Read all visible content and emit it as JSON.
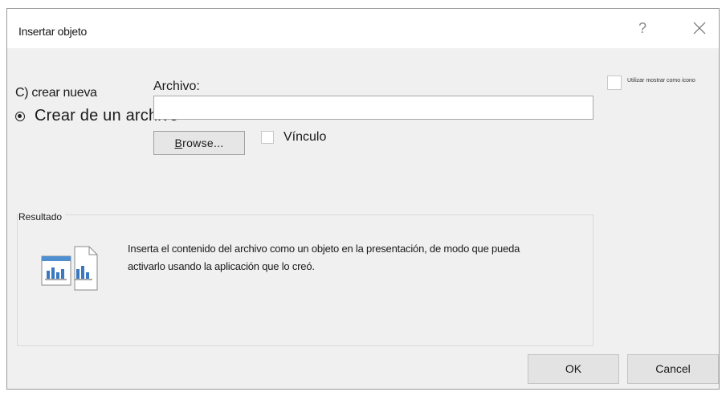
{
  "dialog": {
    "title": "Insertar objeto",
    "help_glyph": "?",
    "close_icon": "close-icon"
  },
  "options": {
    "create_new_label": "C) crear nueva",
    "create_from_file_label": "Crear de un archivo",
    "selected": "create_from_file"
  },
  "file": {
    "label": "Archivo:",
    "value": "",
    "browse_label": "Browse...",
    "browse_accel": "B",
    "browse_rest": "rowse...",
    "link_label": "Vínculo",
    "link_checked": false
  },
  "display_as_icon": {
    "label": "Utilizar mostrar como icono",
    "checked": false
  },
  "result": {
    "group_label": "Resultado",
    "description": "Inserta el contenido del archivo como un objeto en la presentación, de modo que pueda activarlo usando la aplicación que lo creó.",
    "icon": "embedded-object-icon"
  },
  "buttons": {
    "ok_label": "OK",
    "cancel_label": "Cancel"
  }
}
